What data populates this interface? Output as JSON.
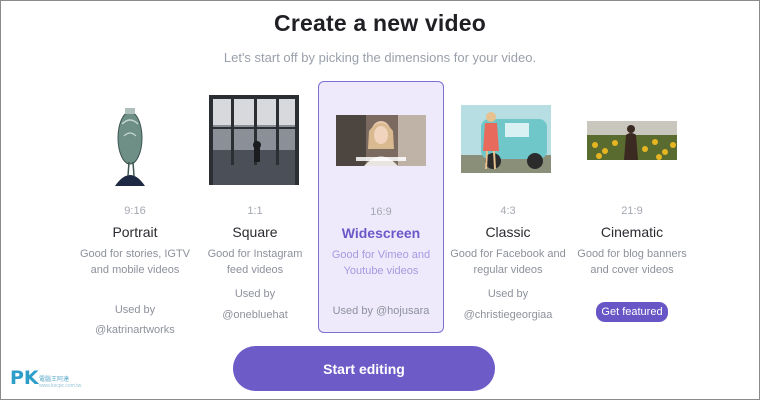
{
  "header": {
    "title": "Create a new video",
    "subtitle": "Let's start off by picking the dimensions for your video."
  },
  "options": [
    {
      "ratio": "9:16",
      "name": "Portrait",
      "description": "Good for stories, IGTV and mobile videos",
      "used_by_label": "Used by",
      "used_by_user": "@katrinartworks",
      "selected": false
    },
    {
      "ratio": "1:1",
      "name": "Square",
      "description": "Good for Instagram feed videos",
      "used_by_label": "Used by",
      "used_by_user": "@onebluehat",
      "selected": false
    },
    {
      "ratio": "16:9",
      "name": "Widescreen",
      "description": "Good for Vimeo and Youtube videos",
      "used_by_label": "Used by",
      "used_by_user": "@hojusara",
      "selected": true
    },
    {
      "ratio": "4:3",
      "name": "Classic",
      "description": "Good for Facebook and regular videos",
      "used_by_label": "Used by",
      "used_by_user": "@christiegeorgiaa",
      "selected": false
    },
    {
      "ratio": "21:9",
      "name": "Cinematic",
      "description": "Good for blog banners and cover videos",
      "badge": "Get featured",
      "selected": false
    }
  ],
  "actions": {
    "start_label": "Start editing"
  },
  "watermark": {
    "logo": "PK",
    "caption": "電腦王阿達",
    "caption_small": "www.kocpc.com.tw"
  },
  "colors": {
    "accent": "#6d5cc8",
    "selected_bg": "#eeeafb",
    "muted_text": "#8d919b"
  }
}
